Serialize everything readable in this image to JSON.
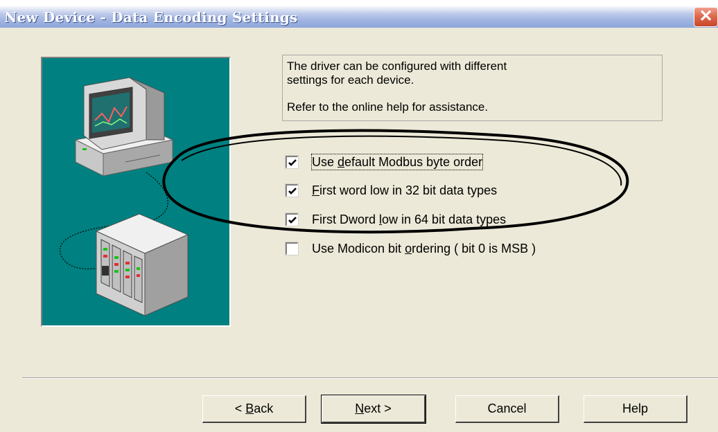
{
  "window": {
    "title": "New Device - Data Encoding Settings",
    "close_symbol": "✕"
  },
  "info": {
    "line1": "The driver can be configured with different",
    "line2": "settings for each device.",
    "line3": "Refer to the online help for assistance."
  },
  "options": [
    {
      "pre": "Use ",
      "key": "d",
      "post": "efault Modbus byte order",
      "checked": true
    },
    {
      "pre": "",
      "key": "F",
      "post": "irst word low in 32 bit data types",
      "checked": true
    },
    {
      "pre": "First Dword ",
      "key": "l",
      "post": "ow in 64 bit data types",
      "checked": true
    },
    {
      "pre": "Use Modicon bit ",
      "key": "o",
      "post": "rdering ( bit 0 is MSB )",
      "checked": false
    }
  ],
  "buttons": {
    "back": {
      "pre": "< ",
      "key": "B",
      "post": "ack"
    },
    "next": {
      "pre": "",
      "key": "N",
      "post": "ext >"
    },
    "cancel": "Cancel",
    "help": "Help"
  },
  "icons": [
    "close-icon",
    "computer-icon",
    "device-rack-icon",
    "checkmark-icon"
  ],
  "colors": {
    "dialog_bg": "#ece9d8",
    "illustration_bg": "#008080",
    "title_gradient_end": "#8ea6db",
    "close_button": "#e06a4c"
  }
}
